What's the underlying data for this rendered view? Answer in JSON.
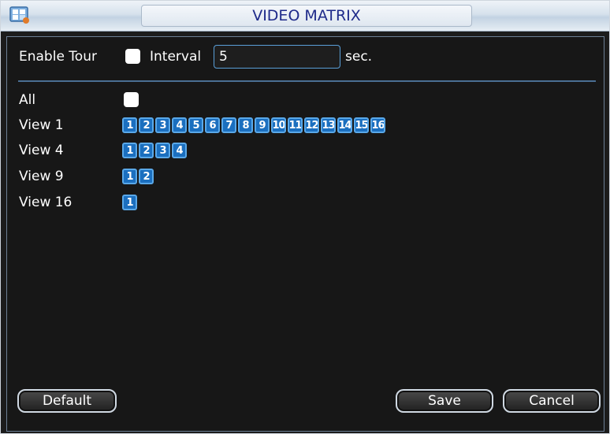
{
  "window": {
    "title": "VIDEO MATRIX"
  },
  "tour": {
    "enable_label": "Enable Tour",
    "interval_label": "Interval",
    "interval_value": "5",
    "unit": "sec."
  },
  "views": {
    "all_label": "All",
    "rows": [
      {
        "label": "View 1",
        "chips": [
          "1",
          "2",
          "3",
          "4",
          "5",
          "6",
          "7",
          "8",
          "9",
          "10",
          "11",
          "12",
          "13",
          "14",
          "15",
          "16"
        ]
      },
      {
        "label": "View 4",
        "chips": [
          "1",
          "2",
          "3",
          "4"
        ]
      },
      {
        "label": "View 9",
        "chips": [
          "1",
          "2"
        ]
      },
      {
        "label": "View 16",
        "chips": [
          "1"
        ]
      }
    ]
  },
  "buttons": {
    "default": "Default",
    "save": "Save",
    "cancel": "Cancel"
  }
}
